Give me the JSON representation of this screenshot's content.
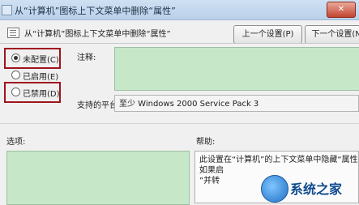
{
  "window": {
    "title": "从“计算机”图标上下文菜单中删除“属性”",
    "close_label": "✕"
  },
  "header": {
    "policy_title": "从“计算机”图标上下文菜单中删除“属性”",
    "prev_button": "上一个设置(P)",
    "next_button": "下一个设置(N)"
  },
  "options": {
    "not_configured": "未配置(C)",
    "enabled": "已启用(E)",
    "disabled": "已禁用(D)",
    "selected": "not_configured"
  },
  "labels": {
    "comment": "注释:",
    "platform": "支持的平台:",
    "options": "选项:",
    "help": "帮助:"
  },
  "platform_value": "至少 Windows 2000 Service Pack 3",
  "help_text": [
    "此设置在“计算机”的上下文菜单中隐藏“属性”",
    "如果启",
    "”并转"
  ],
  "watermark": {
    "text": "系统之家"
  },
  "colors": {
    "highlight_box": "#a0141e",
    "disabled_field": "#c7e7c9"
  }
}
